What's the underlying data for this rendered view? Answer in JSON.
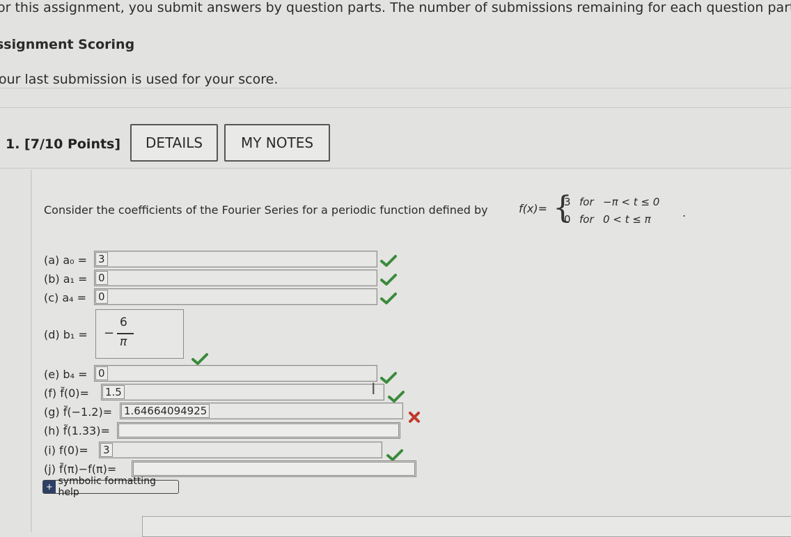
{
  "page": {
    "banner_text": "or this assignment, you submit answers by question parts. The number of submissions remaining for each question part o",
    "scoring_heading": "ssignment Scoring",
    "last_submission_text": "our last submission is used for your score."
  },
  "question": {
    "number_points": "1.  [7/10 Points]",
    "details_label": "DETAILS",
    "notes_label": "MY NOTES",
    "prompt": "Consider the coefficients of the Fourier Series for a periodic function defined by",
    "function_name": "f(x)=",
    "piecewise": [
      {
        "value": "3",
        "for": "for",
        "condition": "−π < t ≤ 0"
      },
      {
        "value": "0",
        "for": "for",
        "condition": "0  < t ≤ π"
      }
    ],
    "period_mark": ".",
    "parts": [
      {
        "label": "(a) a₀ =",
        "value": "3",
        "status": "correct"
      },
      {
        "label": "(b) a₁ =",
        "value": "0",
        "status": "correct"
      },
      {
        "label": "(c) a₄ =",
        "value": "0",
        "status": "correct"
      },
      {
        "label": "(d) b₁ =",
        "value_minus": "−",
        "value_num": "6",
        "value_den": "π",
        "status": "correct"
      },
      {
        "label": "(e) b₄ =",
        "value": "0",
        "status": "correct"
      },
      {
        "label": "(f) f̃(0)=",
        "value": "1.5",
        "status": "correct"
      },
      {
        "label": "(g) f̃(−1.2)=",
        "value": "1.64664094925",
        "status": "incorrect"
      },
      {
        "label": "(h) f̃(1.33)=",
        "value": "",
        "status": "unanswered"
      },
      {
        "label": "(i) f(0)=",
        "value": "3",
        "status": "correct"
      },
      {
        "label": "(j) f̃(π)−f(π)=",
        "value": "",
        "status": "unanswered"
      }
    ],
    "symbolic_help_label": "symbolic formatting help",
    "symbolic_help_icon": "+",
    "colors": {
      "correct": "#3a8a3a",
      "incorrect": "#c0392b",
      "help_icon_bg": "#2e3f66"
    }
  }
}
